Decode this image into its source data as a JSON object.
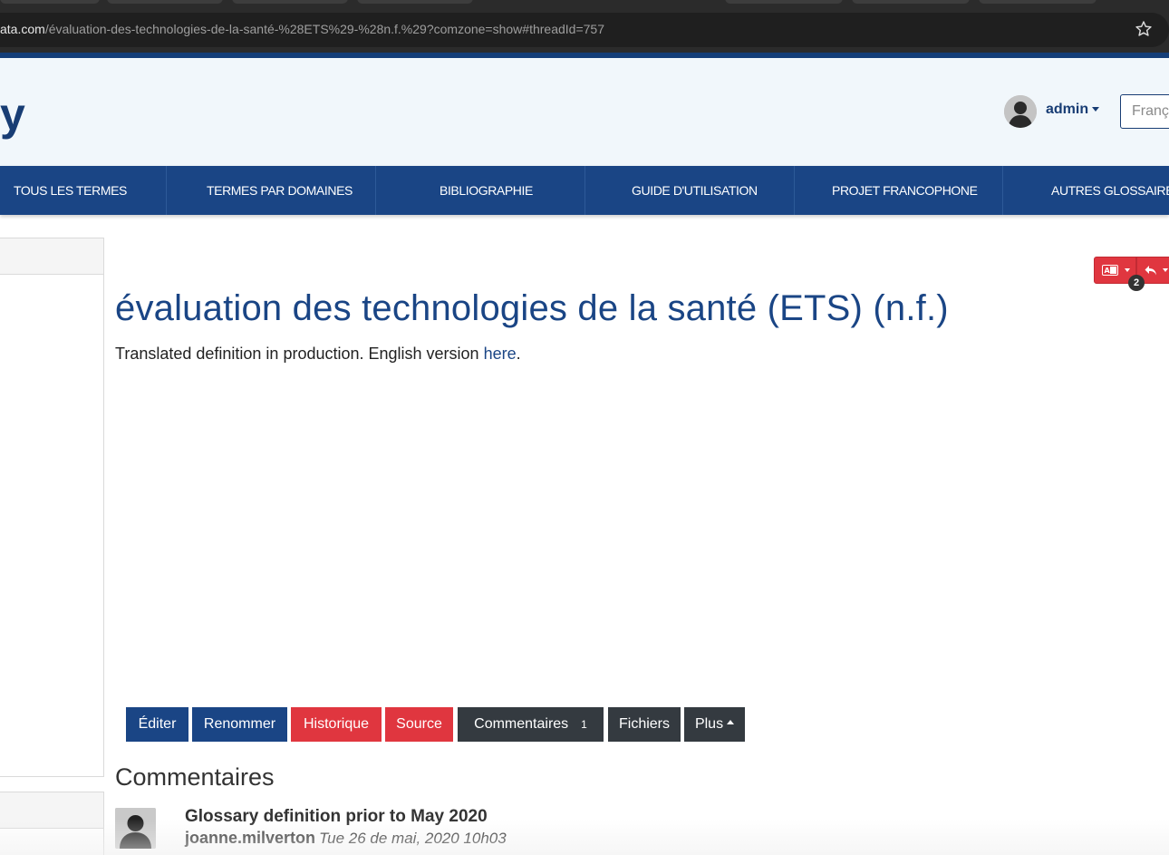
{
  "browser": {
    "url_host": "ata.com",
    "url_path": "/évaluation-des-technologies-de-la-santé-%28ETS%29-%28n.f.%29?comzone=show#threadId=757"
  },
  "header": {
    "logo_text": "y",
    "user_label": "admin",
    "language_value": "Français"
  },
  "nav": {
    "items": [
      "TOUS LES TERMES",
      "TERMES PAR DOMAINES",
      "BIBLIOGRAPHIE",
      "GUIDE D'UTILISATION",
      "PROJET FRANCOPHONE",
      "AUTRES GLOSSAIRES"
    ]
  },
  "actions": {
    "badge_count": "2"
  },
  "page": {
    "title": "évaluation des technologies de la santé (ETS) (n.f.)",
    "definition_text": "Translated definition in production. English version ",
    "definition_link": "here",
    "definition_end": "."
  },
  "toolbar": {
    "edit": "Éditer",
    "rename": "Renommer",
    "history": "Historique",
    "source": "Source",
    "comments": "Commentaires",
    "comments_count": "1",
    "files": "Fichiers",
    "more": "Plus"
  },
  "comments": {
    "heading": "Commentaires",
    "items": [
      {
        "title": "Glossary definition prior to May 2020",
        "author": "joanne.milverton",
        "date": "Tue 26 de mai, 2020 10h03"
      }
    ]
  }
}
